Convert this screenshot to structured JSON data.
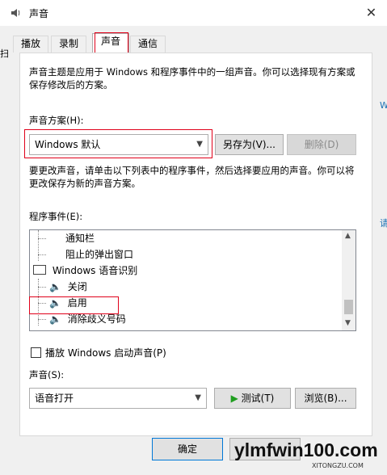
{
  "window": {
    "title": "声音",
    "close_glyph": "✕"
  },
  "tabs": [
    {
      "label": "播放"
    },
    {
      "label": "录制"
    },
    {
      "label": "声音"
    },
    {
      "label": "通信"
    }
  ],
  "intro_text": "声音主题是应用于 Windows 和程序事件中的一组声音。你可以选择现有方案或保存修改后的方案。",
  "scheme": {
    "label": "声音方案(H):",
    "value": "Windows 默认",
    "save_as": "另存为(V)...",
    "delete": "删除(D)"
  },
  "change_text": "要更改声音，请单击以下列表中的程序事件，然后选择要应用的声音。你可以将更改保存为新的声音方案。",
  "events": {
    "label": "程序事件(E):",
    "items": [
      {
        "label": "通知栏"
      },
      {
        "label": "阻止的弹出窗口"
      },
      {
        "label": "Windows 语音识别"
      },
      {
        "label": "关闭"
      },
      {
        "label": "启用"
      },
      {
        "label": "消除歧义号码"
      }
    ]
  },
  "startup_sound": {
    "label": "播放 Windows 启动声音(P)",
    "checked": false
  },
  "sound": {
    "label": "声音(S):",
    "value": "语音打开",
    "test": "测试(T)",
    "browse": "浏览(B)..."
  },
  "footer": {
    "ok": "确定"
  },
  "watermark": {
    "text": "ylmfwin100.com",
    "sub": "XITONGZU.COM"
  },
  "desktop_fragments": {
    "a": "Wi",
    "b": "请",
    "left": "扫"
  },
  "colors": {
    "highlight_red": "#e0001a",
    "play_green": "#1f9e1f"
  }
}
